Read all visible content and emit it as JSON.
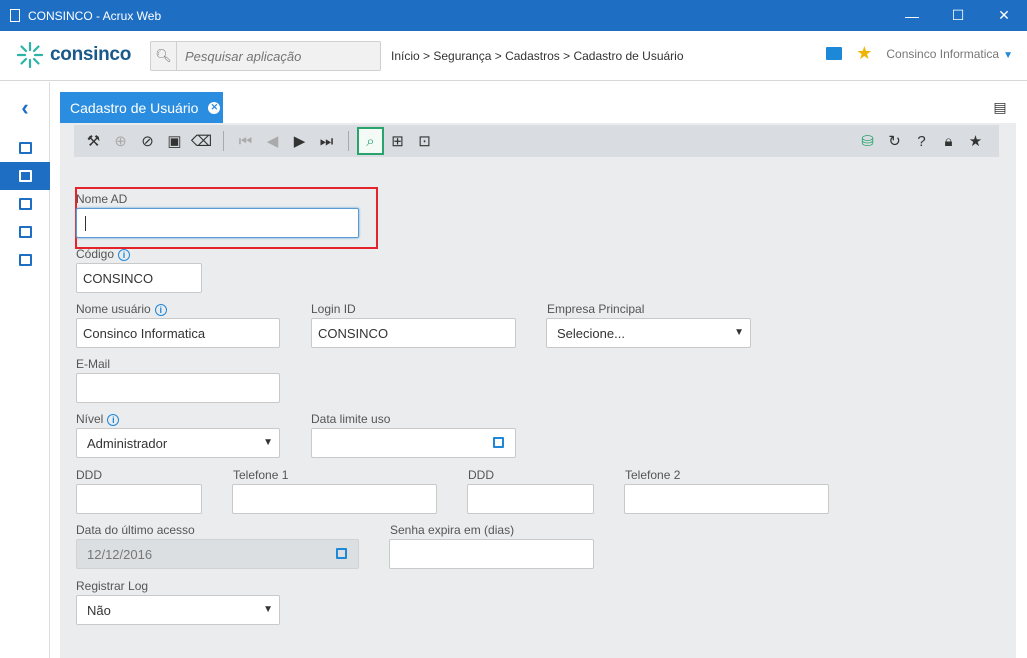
{
  "window": {
    "title": "CONSINCO - Acrux Web"
  },
  "header": {
    "brand": "consinco",
    "search_placeholder": "Pesquisar aplicação",
    "breadcrumb": "Início > Segurança > Cadastros > Cadastro de Usuário",
    "company": "Consinco Informatica"
  },
  "tab": {
    "label": "Cadastro de Usuário"
  },
  "form": {
    "nome_ad": {
      "label": "Nome AD",
      "value": ""
    },
    "codigo": {
      "label": "Código",
      "value": "CONSINCO"
    },
    "nome_usuario": {
      "label": "Nome usuário",
      "value": "Consinco Informatica"
    },
    "login_id": {
      "label": "Login ID",
      "value": "CONSINCO"
    },
    "empresa_principal": {
      "label": "Empresa Principal",
      "value": "Selecione..."
    },
    "email": {
      "label": "E-Mail",
      "value": ""
    },
    "nivel": {
      "label": "Nível",
      "value": "Administrador"
    },
    "data_limite": {
      "label": "Data limite uso",
      "value": ""
    },
    "ddd1": {
      "label": "DDD",
      "value": ""
    },
    "telefone1": {
      "label": "Telefone 1",
      "value": ""
    },
    "ddd2": {
      "label": "DDD",
      "value": ""
    },
    "telefone2": {
      "label": "Telefone 2",
      "value": ""
    },
    "ultimo_acesso": {
      "label": "Data do último acesso",
      "value": "12/12/2016"
    },
    "senha_expira": {
      "label": "Senha expira em (dias)",
      "value": ""
    },
    "registrar_log": {
      "label": "Registrar Log",
      "value": "Não"
    }
  },
  "colors": {
    "titlebar": "#1e6fc4",
    "tab": "#2b8de0",
    "highlight": "#e3242b",
    "accent_green": "#27a36b"
  }
}
